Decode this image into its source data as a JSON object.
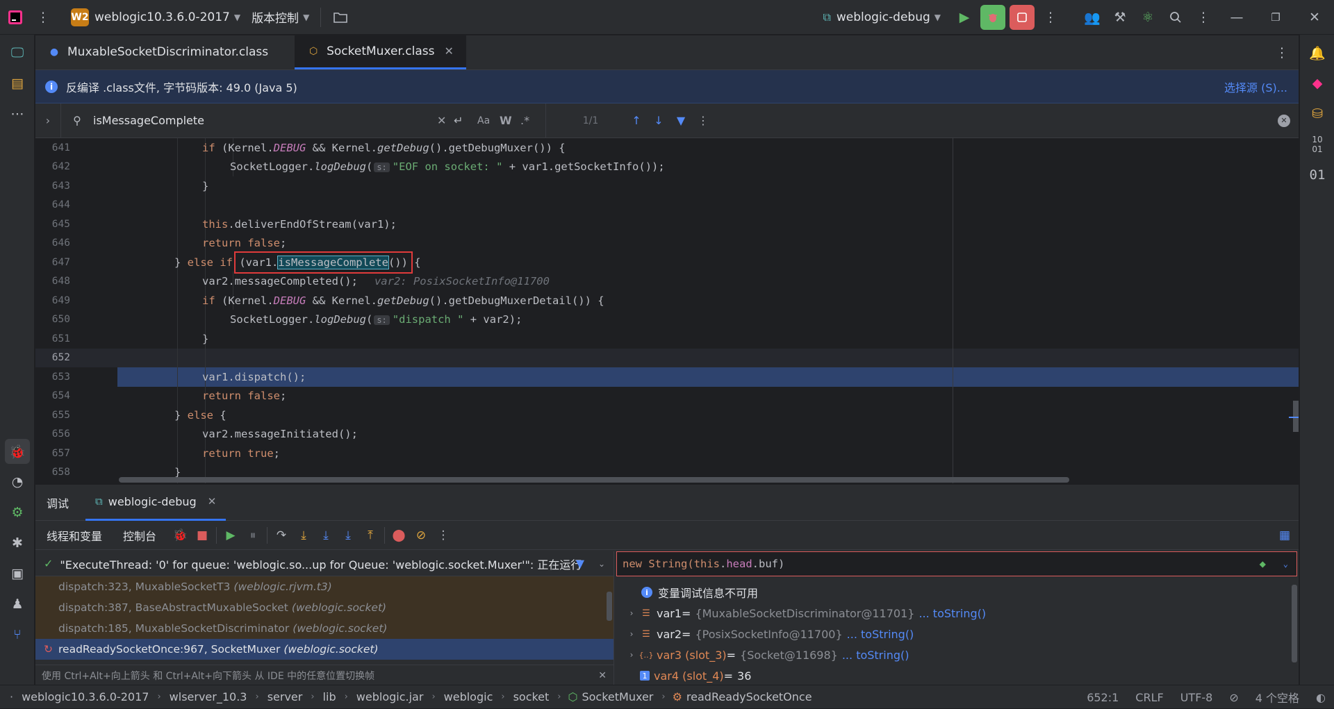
{
  "titlebar": {
    "project_badge": "W2",
    "project_name": "weblogic10.3.6.0-2017",
    "vcs_label": "版本控制",
    "run_config": "weblogic-debug"
  },
  "editor": {
    "tabs": [
      {
        "label": "MuxableSocketDiscriminator.class",
        "active": false
      },
      {
        "label": "SocketMuxer.class",
        "active": true
      }
    ],
    "banner_text": "反编译 .class文件, 字节码版本: 49.0 (Java 5)",
    "banner_link": "选择源 (S)...",
    "find": {
      "query": "isMessageComplete",
      "match_count": "1/1",
      "case_label": "Aa",
      "word_label": "W",
      "regex_label": ".*"
    },
    "lines": [
      {
        "n": "641"
      },
      {
        "n": "642"
      },
      {
        "n": "643"
      },
      {
        "n": "644"
      },
      {
        "n": "645"
      },
      {
        "n": "646"
      },
      {
        "n": "647"
      },
      {
        "n": "648"
      },
      {
        "n": "649"
      },
      {
        "n": "650"
      },
      {
        "n": "651"
      },
      {
        "n": "652"
      },
      {
        "n": "653"
      },
      {
        "n": "654"
      },
      {
        "n": "655"
      },
      {
        "n": "656"
      },
      {
        "n": "657"
      },
      {
        "n": "658"
      }
    ],
    "code": {
      "l641": {
        "a": "if (Kernel.",
        "b": "DEBUG",
        "c": " && Kernel.",
        "d": "getDebug",
        "e": "().getDebugMuxer()) {"
      },
      "l642": {
        "a": "SocketLogger.",
        "b": "logDebug",
        "c": "(",
        "hint": "s:",
        "d": "\"EOF on socket: \"",
        "e": " + var1.getSocketInfo());"
      },
      "l643": "}",
      "l645": {
        "a": "this",
        "b": ".deliverEndOfStream(var1);"
      },
      "l646": {
        "a": "return false",
        "b": ";"
      },
      "l647": {
        "a": "} else if ",
        "b": "(var1.",
        "c": "isMessageComplete",
        "d": "()) {"
      },
      "l648": {
        "a": "var2.messageCompleted();",
        "hint": "var2: PosixSocketInfo@11700"
      },
      "l649": {
        "a": "if (Kernel.",
        "b": "DEBUG",
        "c": " && Kernel.",
        "d": "getDebug",
        "e": "().getDebugMuxerDetail()) {"
      },
      "l650": {
        "a": "SocketLogger.",
        "b": "logDebug",
        "c": "(",
        "hint": "s:",
        "d": "\"dispatch \"",
        "e": " + var2);"
      },
      "l651": "}",
      "l653": "var1.dispatch();",
      "l654": {
        "a": "return false",
        "b": ";"
      },
      "l655": {
        "a": "} else ",
        "b": "{"
      },
      "l656": "var2.messageInitiated();",
      "l657": {
        "a": "return true",
        "b": ";"
      },
      "l658": "}"
    }
  },
  "debug": {
    "panel_title": "调试",
    "session_tab": "weblogic-debug",
    "sub_tabs": [
      "线程和变量",
      "控制台"
    ],
    "thread": "\"ExecuteThread: '0' for queue: 'weblogic.so...up for Queue: 'weblogic.socket.Muxer'\": 正在运行",
    "frames": [
      {
        "method": "dispatch:323, MuxableSocketT3",
        "pkg": "(weblogic.rjvm.t3)",
        "active": false
      },
      {
        "method": "dispatch:387, BaseAbstractMuxableSocket",
        "pkg": "(weblogic.socket)",
        "active": false
      },
      {
        "method": "dispatch:185, MuxableSocketDiscriminator",
        "pkg": "(weblogic.socket)",
        "active": false
      },
      {
        "method": "readReadySocketOnce:967, SocketMuxer",
        "pkg": "(weblogic.socket)",
        "active": true
      }
    ],
    "frames_hint": "使用 Ctrl+Alt+向上箭头 和 Ctrl+Alt+向下箭头 从 IDE 中的任意位置切换帧",
    "eval": {
      "a": "new String(",
      "b": "this",
      "c": ".",
      "d": "head",
      "e": ".buf)"
    },
    "info_row": "变量调试信息不可用",
    "variables": [
      {
        "name": "var1",
        "eq": " = ",
        "value": "{MuxableSocketDiscriminator@11701}",
        "link": "... toString()"
      },
      {
        "name": "var2",
        "eq": " = ",
        "value": "{PosixSocketInfo@11700}",
        "link": "... toString()"
      },
      {
        "name": "var3 (slot_3)",
        "eq": " = ",
        "value": "{Socket@11698}",
        "link": "... toString()"
      },
      {
        "name": "var4 (slot_4)",
        "eq": " = ",
        "value": "36",
        "link": ""
      }
    ]
  },
  "statusbar": {
    "crumbs": [
      "weblogic10.3.6.0-2017",
      "wlserver_10.3",
      "server",
      "lib",
      "weblogic.jar",
      "weblogic",
      "socket",
      "SocketMuxer",
      "readReadySocketOnce"
    ],
    "position": "652:1",
    "line_sep": "CRLF",
    "encoding": "UTF-8",
    "indent": "4 个空格"
  },
  "colors": {
    "accent": "#3574f0",
    "error_red": "#db5c5c",
    "run_green": "#5fb865"
  }
}
